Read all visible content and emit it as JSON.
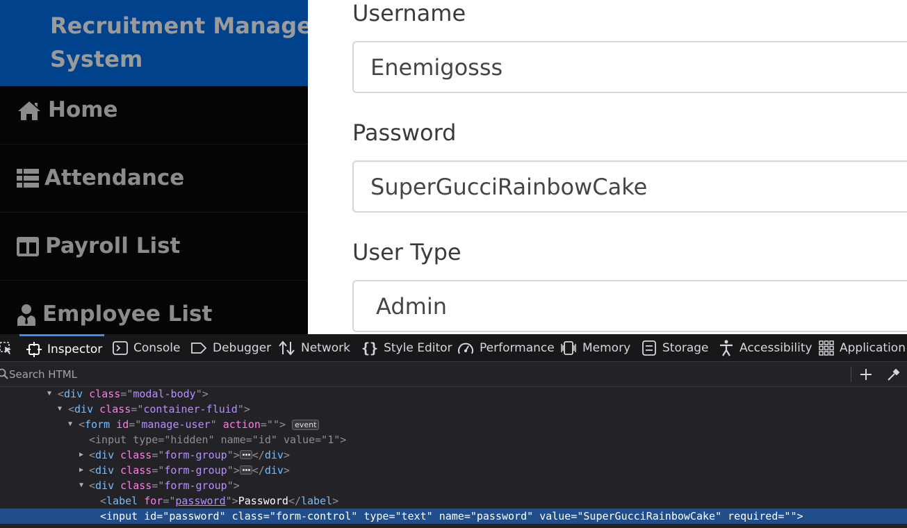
{
  "sidebar": {
    "brand": "Recruitment Management System",
    "items": [
      {
        "label": "Home",
        "icon": "home-icon"
      },
      {
        "label": "Attendance",
        "icon": "list-icon"
      },
      {
        "label": "Payroll List",
        "icon": "columns-icon"
      },
      {
        "label": "Employee List",
        "icon": "user-tie-icon"
      }
    ]
  },
  "form": {
    "username_label": "Username",
    "username_value": "Enemigosss",
    "password_label": "Password",
    "password_value": "SuperGucciRainbowCake",
    "usertype_label": "User Type",
    "usertype_value": "Admin"
  },
  "devtools": {
    "tabs": [
      {
        "label": "Inspector",
        "icon": "inspector-icon",
        "active": true
      },
      {
        "label": "Console",
        "icon": "console-icon"
      },
      {
        "label": "Debugger",
        "icon": "debugger-icon"
      },
      {
        "label": "Network",
        "icon": "network-icon"
      },
      {
        "label": "Style Editor",
        "icon": "style-editor-icon"
      },
      {
        "label": "Performance",
        "icon": "performance-icon"
      },
      {
        "label": "Memory",
        "icon": "memory-icon"
      },
      {
        "label": "Storage",
        "icon": "storage-icon"
      },
      {
        "label": "Accessibility",
        "icon": "accessibility-icon"
      },
      {
        "label": "Application",
        "icon": "application-icon"
      }
    ],
    "search_placeholder": "Search HTML",
    "tree": {
      "l1": {
        "tag": "div",
        "attr": "class",
        "val": "modal-body"
      },
      "l2": {
        "tag": "div",
        "attr": "class",
        "val": "container-fluid"
      },
      "l3": {
        "tag": "form",
        "a1": "id",
        "v1": "manage-user",
        "a2": "action",
        "v2": "",
        "badge": "event"
      },
      "l4": {
        "tag": "input",
        "a1": "type",
        "v1": "hidden",
        "a2": "name",
        "v2": "id",
        "a3": "value",
        "v3": "1"
      },
      "l5": {
        "tag": "div",
        "attr": "class",
        "val": "form-group",
        "close": "div"
      },
      "l6": {
        "tag": "div",
        "attr": "class",
        "val": "form-group",
        "close": "div"
      },
      "l7": {
        "tag": "div",
        "attr": "class",
        "val": "form-group"
      },
      "l8": {
        "tag": "label",
        "attr": "for",
        "val": "password",
        "text": "Password",
        "close": "label"
      },
      "l9": {
        "tag": "input",
        "a1": "id",
        "v1": "password",
        "a2": "class",
        "v2": "form-control",
        "a3": "type",
        "v3": "text",
        "a4": "name",
        "v4": "password",
        "a5": "value",
        "v5": "SuperGucciRainbowCake",
        "a6": "required",
        "v6": ""
      }
    }
  }
}
